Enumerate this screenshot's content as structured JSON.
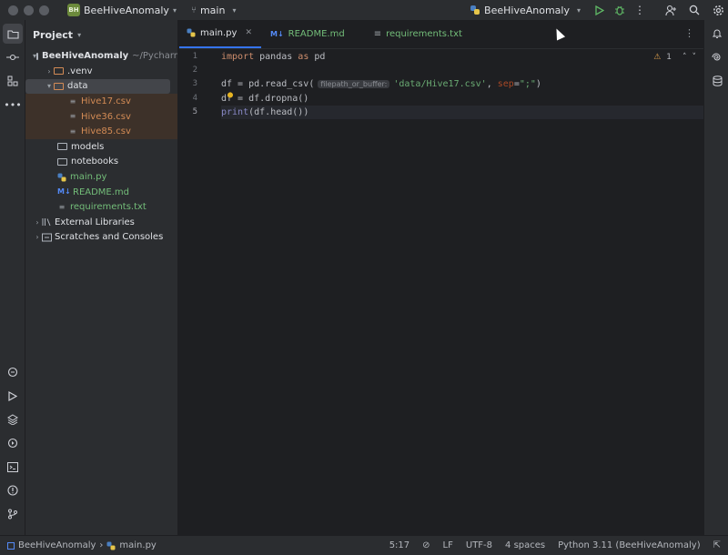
{
  "titlebar": {
    "project_badge": "BH",
    "project_name": "BeeHiveAnomaly",
    "branch": "main",
    "run_config": "BeeHiveAnomaly"
  },
  "project_panel": {
    "title": "Project",
    "root_name": "BeeHiveAnomaly",
    "root_path": "~/PycharmProjects/BeeHiveAnomaly",
    "items": [
      {
        "label": ".venv"
      },
      {
        "label": "data"
      },
      {
        "label": "Hive17.csv"
      },
      {
        "label": "Hive36.csv"
      },
      {
        "label": "Hive85.csv"
      },
      {
        "label": "models"
      },
      {
        "label": "notebooks"
      },
      {
        "label": "main.py"
      },
      {
        "label": "README.md"
      },
      {
        "label": "requirements.txt"
      },
      {
        "label": "External Libraries"
      },
      {
        "label": "Scratches and Consoles"
      }
    ]
  },
  "tabs": [
    {
      "label": "main.py"
    },
    {
      "label": "README.md"
    },
    {
      "label": "requirements.txt"
    }
  ],
  "editor": {
    "line_numbers": [
      "1",
      "2",
      "3",
      "4",
      "5"
    ],
    "line1_kw": "import",
    "line1_mod": " pandas ",
    "line1_as": "as",
    "line1_alias": " pd",
    "line3_pre": "df = pd.read_csv(",
    "line3_hint": "filepath_or_buffer:",
    "line3_str": "'data/Hive17.csv'",
    "line3_comma": ", ",
    "line3_param": "sep",
    "line3_eq": "=",
    "line3_sep": "\";\"",
    "line3_close": ")",
    "line4": "df = df.dropna()",
    "line5_fn": "print",
    "line5_rest": "(df.head())",
    "warning_count": "1"
  },
  "statusbar": {
    "crumb_project": "BeeHiveAnomaly",
    "crumb_file": "main.py",
    "position": "5:17",
    "line_sep": "LF",
    "encoding": "UTF-8",
    "indent": "4 spaces",
    "interpreter": "Python 3.11 (BeeHiveAnomaly)"
  }
}
